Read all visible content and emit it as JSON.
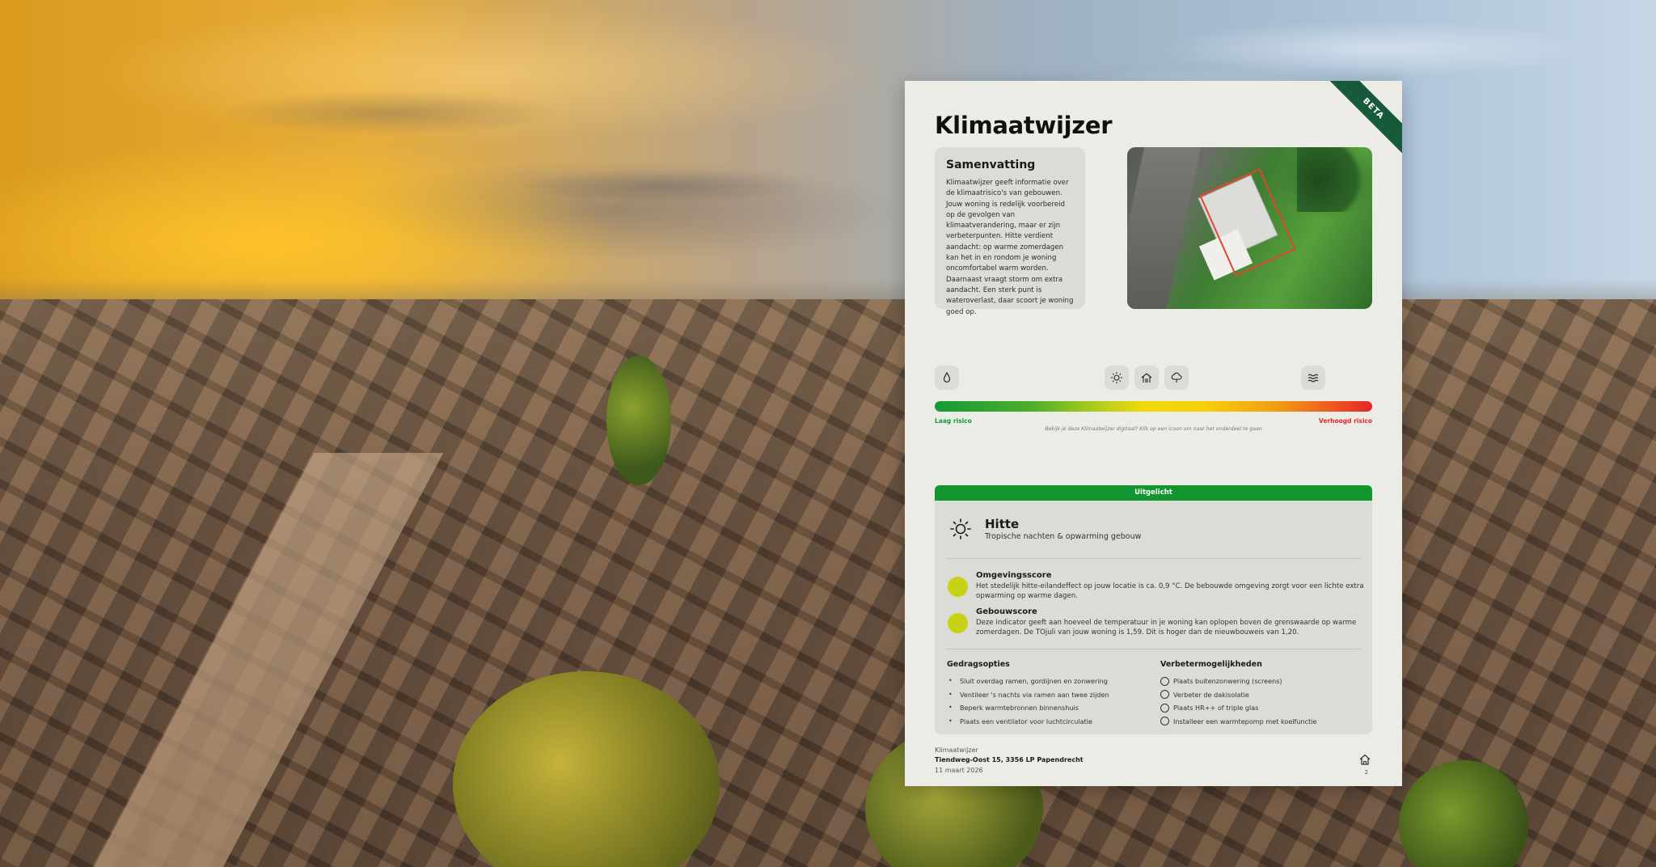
{
  "card": {
    "badge": "BETA",
    "title": "Klimaatwijzer",
    "summary": {
      "heading": "Samenvatting",
      "text": "Klimaatwijzer geeft informatie over de klimaatrisico's van gebouwen. Jouw woning is redelijk voorbereid op de gevolgen van klimaatverandering, maar er zijn verbeterpunten. Hitte verdient aandacht: op warme zomerdagen kan het in en rondom je woning oncomfortabel warm worden. Daarnaast vraagt storm om extra aandacht. Een sterk punt is wateroverlast, daar scoort je woning goed op."
    },
    "risk_icons": [
      "drop-icon",
      "sun-icon",
      "house-wind-icon",
      "cloud-storm-icon",
      "waves-icon"
    ],
    "scale": {
      "low_label": "Laag risico",
      "high_label": "Verhoogd risico",
      "note": "Bekijk je deze Klimaatwijzer digitaal? Klik op een icoon om naar het onderdeel te gaan",
      "low_color": "#169a36",
      "high_color": "#e4262a"
    },
    "spotlight": {
      "header": "Uitgelicht",
      "icon": "sun-icon",
      "title": "Hitte",
      "subtitle": "Tropische nachten & opwarming gebouw",
      "scores": [
        {
          "title": "Omgevingsscore",
          "text": "Het stedelijk hitte-eilandeffect op jouw locatie is ca. 0,9 °C. De bebouwde omgeving zorgt voor een lichte extra opwarming op warme dagen."
        },
        {
          "title": "Gebouwscore",
          "text": "Deze indicator geeft aan hoeveel de temperatuur in je woning kan oplopen boven de grenswaarde op warme zomerdagen. De TOjuli van jouw woning is 1,59. Dit is hoger dan de nieuwbouweis van 1,20."
        }
      ],
      "behavior": {
        "title": "Gedragsopties",
        "items": [
          "Sluit overdag ramen, gordijnen en zonwering",
          "Ventileer 's nachts via ramen aan twee zijden",
          "Beperk warmtebronnen binnenshuis",
          "Plaats een ventilator voor luchtcirculatie"
        ]
      },
      "improvements": {
        "title": "Verbetermogelijkheden",
        "items": [
          "Plaats buitenzonwering (screens)",
          "Verbeter de dakisolatie",
          "Plaats HR++ of triple glas",
          "Installeer een warmtepomp met koelfunctie"
        ]
      },
      "header_color": "#13962f",
      "dot_color": "#c7d215"
    },
    "footer": {
      "brand": "Klimaatwijzer",
      "address": "Tiendweg-Oost 15, 3356 LP Papendrecht",
      "date": "11 maart 2026",
      "page": "2",
      "home_icon": "home-icon"
    }
  }
}
